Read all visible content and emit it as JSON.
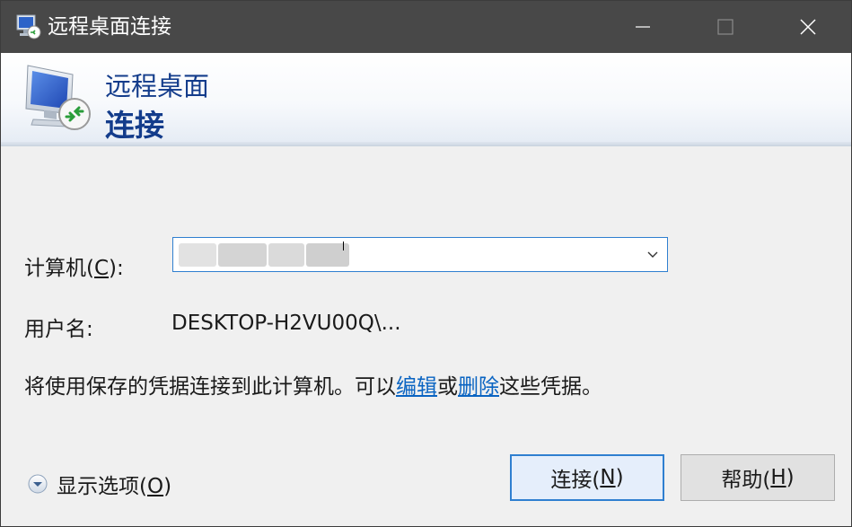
{
  "window": {
    "title": "远程桌面连接",
    "controls": {
      "minimize": "minimize-icon",
      "maximize": "maximize-icon",
      "close": "close-icon"
    }
  },
  "header": {
    "line1": "远程桌面",
    "line2": "连接",
    "icon": "remote-desktop-monitor-icon"
  },
  "form": {
    "computer_label_prefix": "计算机(",
    "computer_label_accel": "C",
    "computer_label_suffix": "):",
    "computer_value": "",
    "user_label": "用户名:",
    "user_value": "DESKTOP-H2VU00Q\\..."
  },
  "info": {
    "before": "将使用保存的凭据连接到此计算机。可以",
    "edit_link": "编辑",
    "middle": "或",
    "delete_link": "删除",
    "after": "这些凭据。"
  },
  "footer": {
    "options_prefix": "显示选项(",
    "options_accel": "O",
    "options_suffix": ")",
    "connect_prefix": "连接(",
    "connect_accel": "N",
    "connect_suffix": ")",
    "help_prefix": "帮助(",
    "help_accel": "H",
    "help_suffix": ")"
  },
  "colors": {
    "titlebar": "#484848",
    "header_text": "#133c8b",
    "link": "#0a64c2",
    "focus_border": "#2f7fd0"
  }
}
